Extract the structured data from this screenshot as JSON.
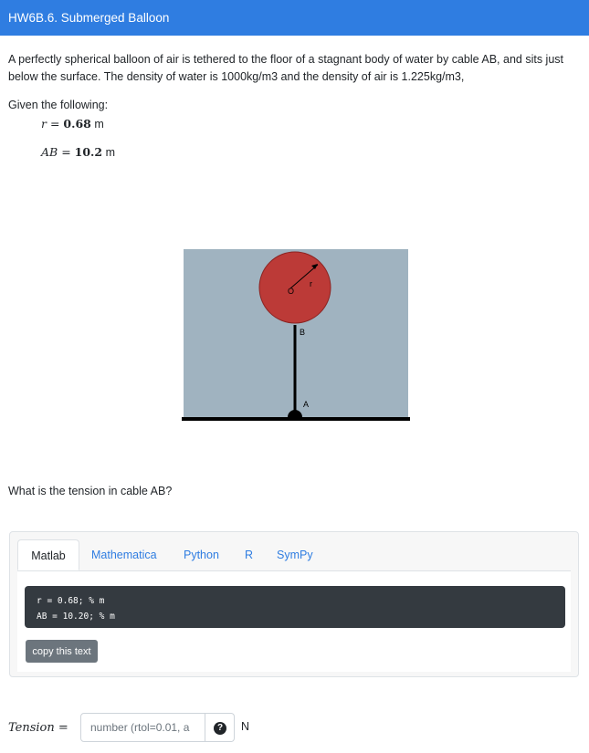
{
  "header": {
    "title": "HW6B.6. Submerged Balloon"
  },
  "problem": {
    "text": "A perfectly spherical balloon of air is tethered to the floor of a stagnant body of water by cable AB, and sits just below the surface. The density of water is 1000kg/m3 and the density of air is 1.225kg/m3,",
    "given_label": "Given the following:",
    "given": [
      {
        "symbol": "r",
        "value": "0.68",
        "unit": "m"
      },
      {
        "symbol": "AB",
        "value": "10.2",
        "unit": "m"
      }
    ]
  },
  "figure": {
    "labels": {
      "center": "O",
      "radius": "r",
      "point_b": "B",
      "point_a": "A"
    },
    "colors": {
      "water": "#a0b3c0",
      "balloon": "#bc3a37",
      "balloon_edge": "#7a1d1b",
      "ground": "#000000"
    }
  },
  "question": {
    "text": "What is the tension in cable AB?"
  },
  "code_tabs": {
    "tabs": [
      "Matlab",
      "Mathematica",
      "Python",
      "R",
      "SymPy"
    ],
    "active": "Matlab",
    "code_lines": [
      "r = 0.68; % m",
      "AB = 10.20; % m"
    ],
    "copy_label": "copy this text"
  },
  "answer": {
    "label": "Tension",
    "equals": "=",
    "placeholder": "number (rtol=0.01, a",
    "value": "",
    "help_icon": "question-circle-icon",
    "help_glyph": "?",
    "unit": "N"
  }
}
